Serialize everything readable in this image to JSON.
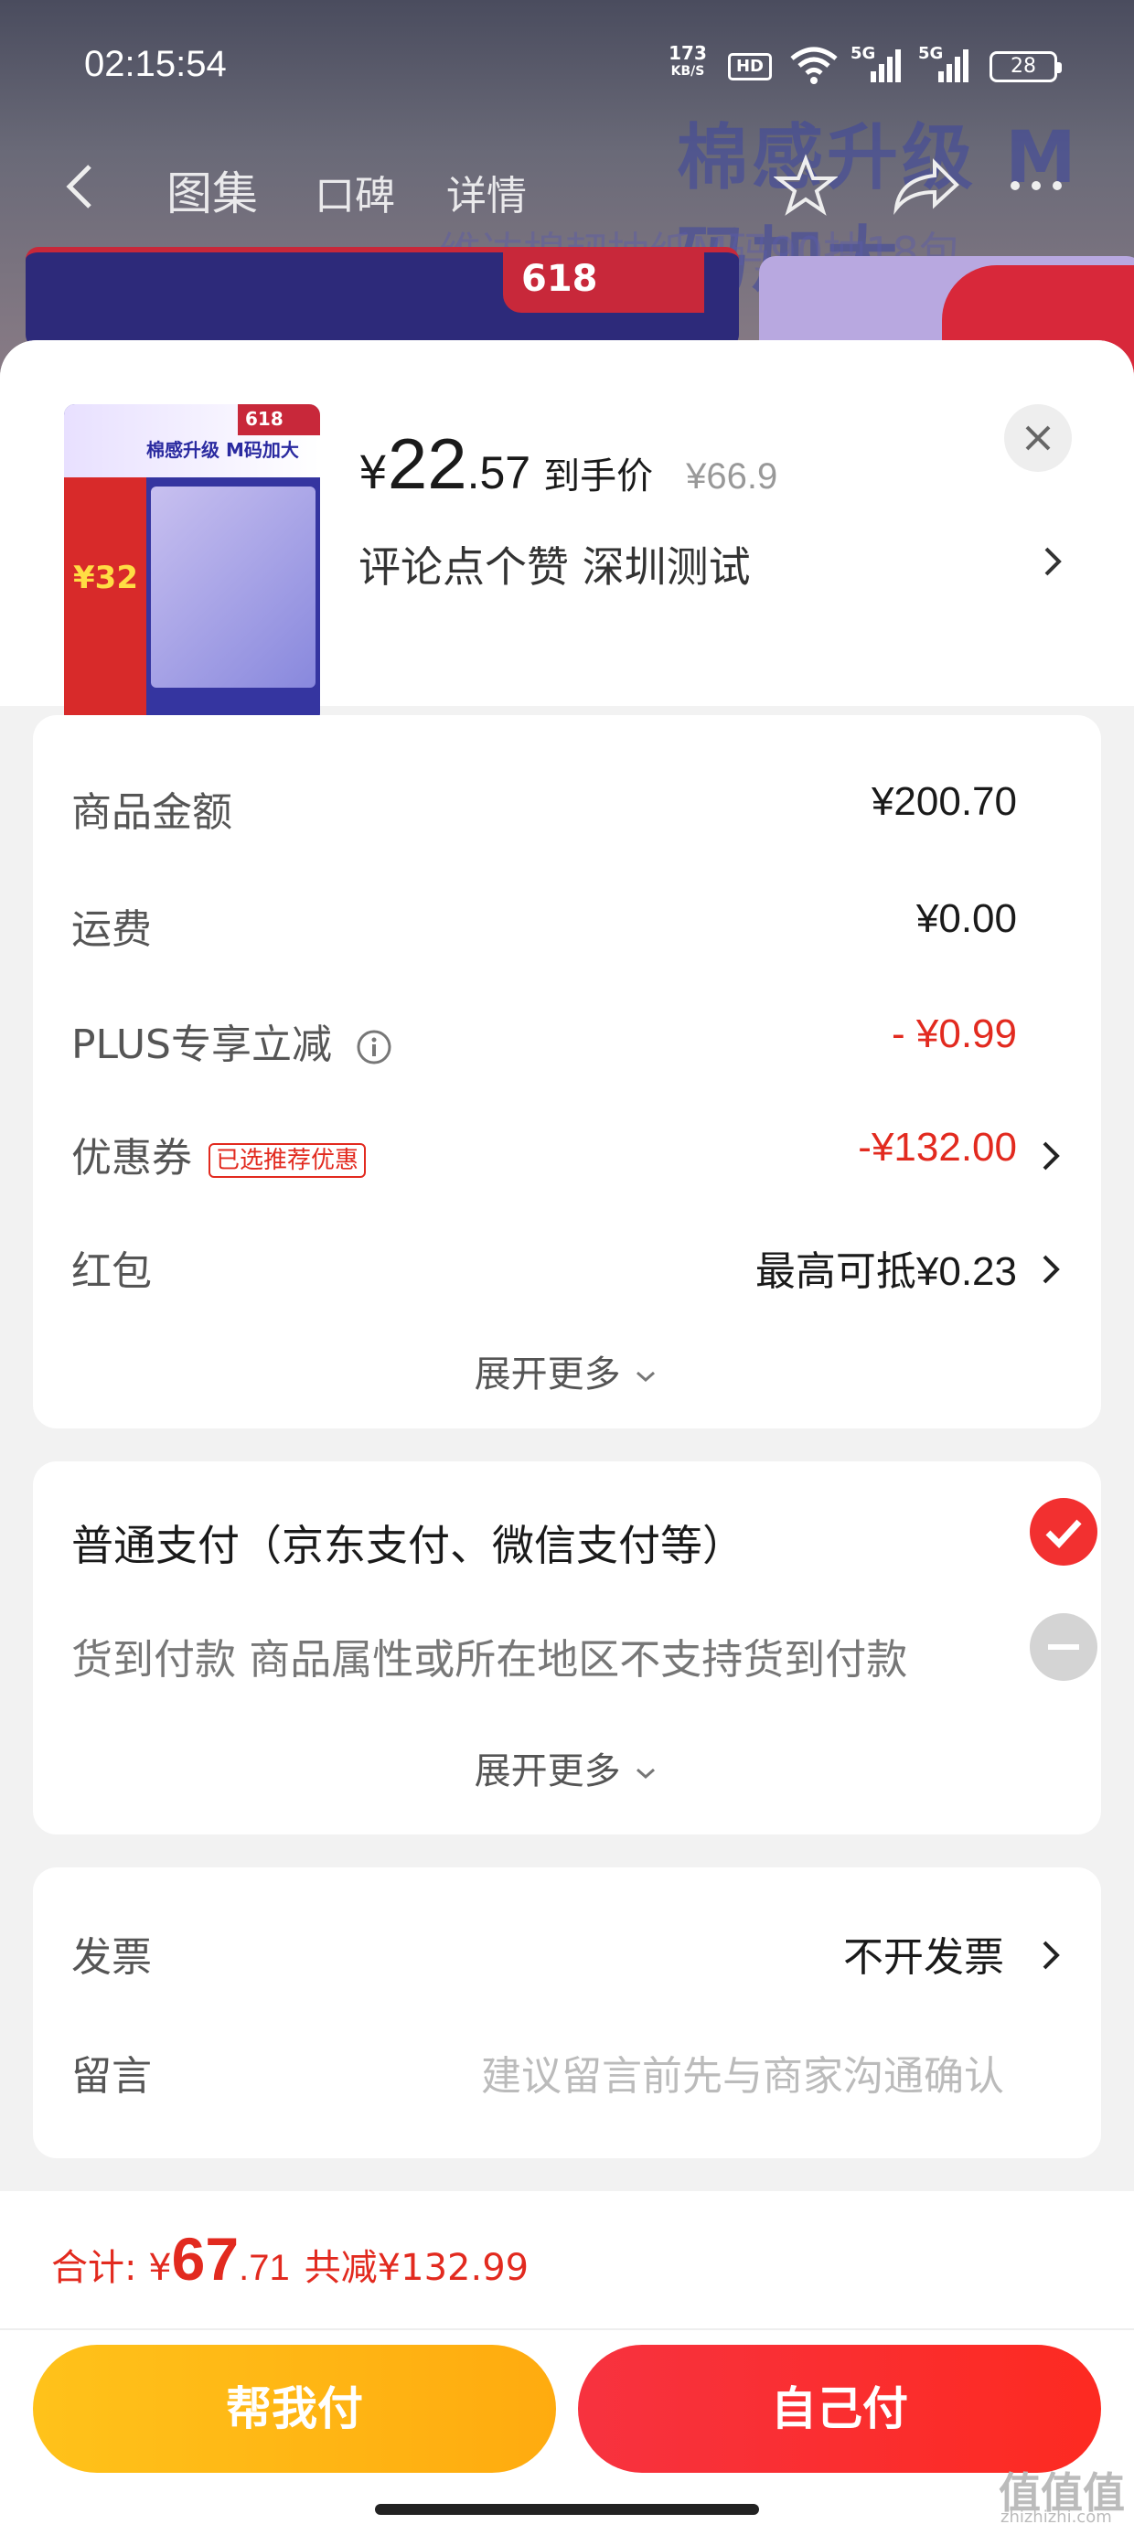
{
  "status_bar": {
    "time": "02:15:54",
    "net_speed": "173",
    "net_unit": "KB/S",
    "hd_badge": "HD",
    "signal_1": "5G",
    "signal_2": "5G",
    "battery": "28"
  },
  "nav": {
    "tabs": [
      "图集",
      "口碑",
      "详情"
    ]
  },
  "background": {
    "deco_1": "棉感升级 M码加大",
    "deco_2": "维达棉韧抽纸M码90抽18包",
    "badge_618": "618"
  },
  "product": {
    "thumb_badge": "618",
    "thumb_title": "棉感升级 M码加大",
    "thumb_price": "¥32",
    "price_symbol": "¥",
    "price_integer": "22",
    "price_decimal": ".57",
    "price_label": "到手价",
    "original_price": "¥66.9",
    "spec": "评论点个赞  深圳测试"
  },
  "costs": {
    "rows": [
      {
        "label": "商品金额",
        "value": "¥200.70"
      },
      {
        "label": "运费",
        "value": "¥0.00"
      },
      {
        "label": "PLUS专享立减",
        "value": "- ¥0.99"
      },
      {
        "label": "优惠券",
        "tag": "已选推荐优惠",
        "value": "-¥132.00"
      },
      {
        "label": "红包",
        "value": "最高可抵¥0.23"
      }
    ],
    "expand_label": "展开更多"
  },
  "payment": {
    "options": [
      {
        "label": "普通支付（京东支付、微信支付等）",
        "state": "selected"
      },
      {
        "label": "货到付款 商品属性或所在地区不支持货到付款",
        "state": "disabled"
      }
    ],
    "expand_label": "展开更多"
  },
  "extras": {
    "invoice_label": "发票",
    "invoice_value": "不开发票",
    "message_label": "留言",
    "message_placeholder": "建议留言前先与商家沟通确认"
  },
  "footer": {
    "total_label": "合计: ",
    "total_symbol": "¥",
    "total_integer": "67",
    "total_decimal": ".71",
    "total_saving": "共减¥132.99",
    "help_pay_button": "帮我付",
    "self_pay_button": "自己付"
  },
  "watermark": {
    "main": "值值值",
    "sub": "zhizhizhi.com"
  },
  "colors": {
    "accent_red": "#e22a1f",
    "help_button": "#ffb416",
    "self_button": "#f72f33"
  }
}
